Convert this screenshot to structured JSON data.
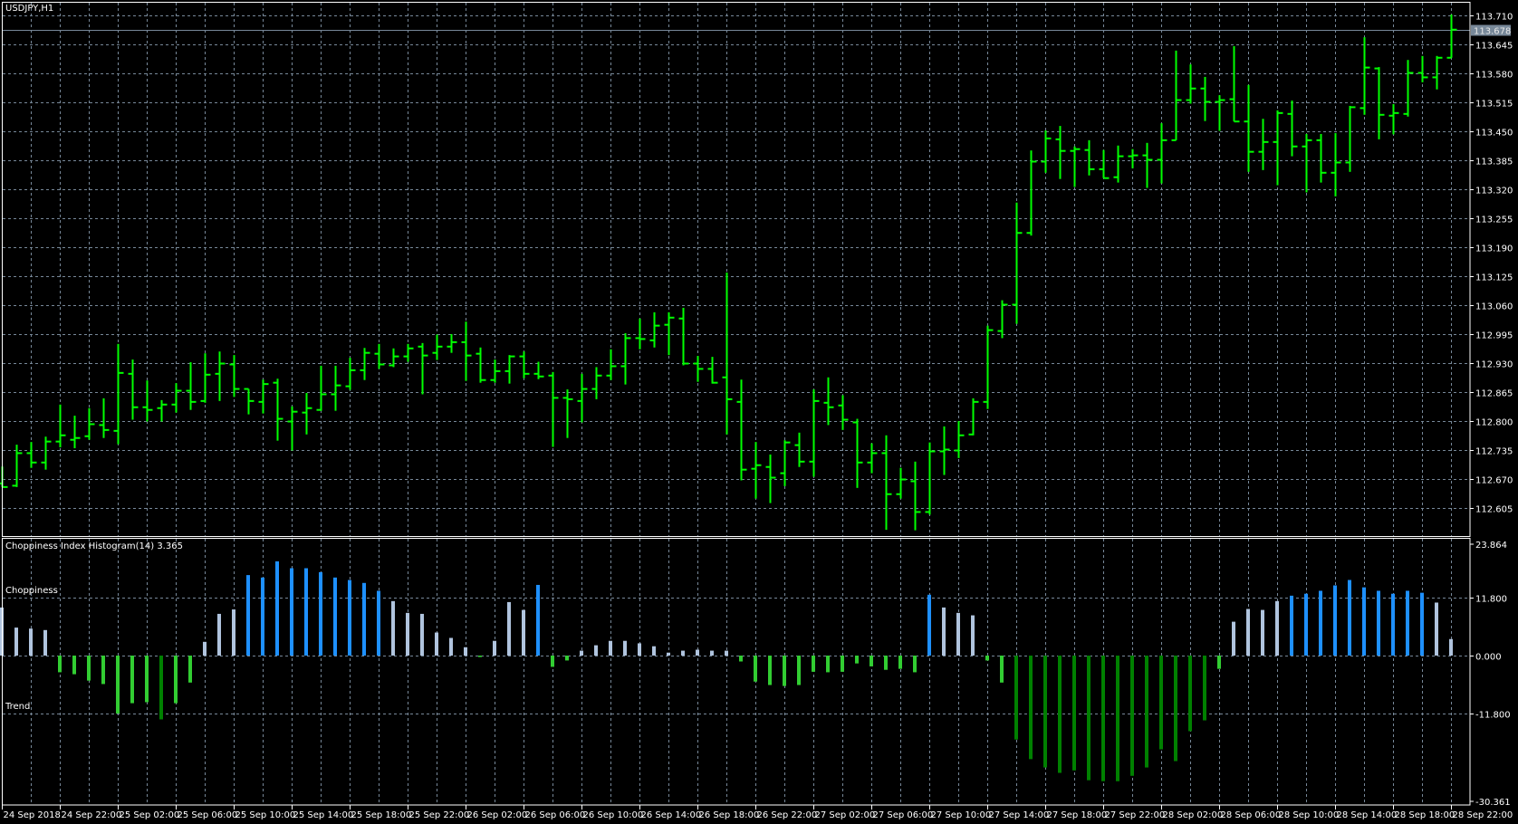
{
  "window": {
    "symbol_title": "USDJPY,H1"
  },
  "indicator": {
    "name": "Choppiness Index Histogram(14)",
    "current_value": "3.365",
    "level_labels": {
      "choppiness": "Choppiness",
      "trend": "Trend"
    }
  },
  "colors": {
    "background": "#000000",
    "grid": "#778899",
    "price_bar": "#00ff00",
    "current_price_line": "#778899",
    "hist_choppy_strong": "#1e90ff",
    "hist_choppy": "#b0c4de",
    "hist_trend": "#32cd32",
    "hist_trend_strong": "#008000"
  },
  "chart_data": [
    {
      "type": "bar",
      "style": "ohlc",
      "title": "USDJPY,H1",
      "ylim": [
        112.605,
        113.71
      ],
      "y_ticks": [
        "113.710",
        "113.645",
        "113.580",
        "113.515",
        "113.450",
        "113.385",
        "113.320",
        "113.255",
        "113.190",
        "113.125",
        "113.060",
        "112.995",
        "112.930",
        "112.865",
        "112.800",
        "112.735",
        "112.670",
        "112.605"
      ],
      "current_price": "113.678",
      "x_tick_labels": [
        "24 Sep 2018",
        "24 Sep 22:00",
        "25 Sep 02:00",
        "25 Sep 06:00",
        "25 Sep 10:00",
        "25 Sep 14:00",
        "25 Sep 18:00",
        "25 Sep 22:00",
        "26 Sep 02:00",
        "26 Sep 06:00",
        "26 Sep 10:00",
        "26 Sep 14:00",
        "26 Sep 18:00",
        "26 Sep 22:00",
        "27 Sep 02:00",
        "27 Sep 06:00",
        "27 Sep 10:00",
        "27 Sep 14:00",
        "27 Sep 18:00",
        "27 Sep 22:00",
        "28 Sep 02:00",
        "28 Sep 06:00",
        "28 Sep 10:00",
        "28 Sep 14:00",
        "28 Sep 18:00",
        "28 Sep 22:00"
      ],
      "grid": true,
      "ohlc": [
        [
          112.66,
          112.698,
          112.652,
          112.652
        ],
        [
          112.655,
          112.747,
          112.652,
          112.728
        ],
        [
          112.728,
          112.753,
          112.695,
          112.707
        ],
        [
          112.707,
          112.765,
          112.691,
          112.754
        ],
        [
          112.754,
          112.837,
          112.741,
          112.768
        ],
        [
          112.758,
          112.812,
          112.739,
          112.762
        ],
        [
          112.766,
          112.829,
          112.758,
          112.793
        ],
        [
          112.791,
          112.851,
          112.762,
          112.78
        ],
        [
          112.778,
          112.973,
          112.748,
          112.908
        ],
        [
          112.906,
          112.938,
          112.803,
          112.831
        ],
        [
          112.831,
          112.891,
          112.799,
          112.825
        ],
        [
          112.829,
          112.847,
          112.799,
          112.837
        ],
        [
          112.837,
          112.885,
          112.819,
          112.868
        ],
        [
          112.868,
          112.932,
          112.825,
          112.843
        ],
        [
          112.845,
          112.952,
          112.841,
          112.904
        ],
        [
          112.906,
          112.956,
          112.845,
          112.929
        ],
        [
          112.927,
          112.948,
          112.854,
          112.872
        ],
        [
          112.872,
          112.872,
          112.815,
          112.845
        ],
        [
          112.843,
          112.893,
          112.817,
          112.883
        ],
        [
          112.886,
          112.895,
          112.756,
          112.805
        ],
        [
          112.799,
          112.833,
          112.734,
          112.821
        ],
        [
          112.819,
          112.863,
          112.77,
          112.829
        ],
        [
          112.825,
          112.924,
          112.823,
          112.86
        ],
        [
          112.86,
          112.924,
          112.823,
          112.88
        ],
        [
          112.878,
          112.942,
          112.87,
          112.914
        ],
        [
          112.914,
          112.964,
          112.892,
          112.953
        ],
        [
          112.951,
          112.973,
          112.917,
          112.927
        ],
        [
          112.925,
          112.963,
          112.921,
          112.945
        ],
        [
          112.945,
          112.973,
          112.933,
          112.963
        ],
        [
          112.967,
          112.975,
          112.86,
          112.947
        ],
        [
          112.953,
          112.994,
          112.937,
          112.967
        ],
        [
          112.967,
          112.995,
          112.953,
          112.977
        ],
        [
          112.977,
          113.023,
          112.89,
          112.947
        ],
        [
          112.951,
          112.965,
          112.886,
          112.892
        ],
        [
          112.892,
          112.938,
          112.886,
          112.912
        ],
        [
          112.912,
          112.948,
          112.884,
          112.945
        ],
        [
          112.945,
          112.956,
          112.896,
          112.906
        ],
        [
          112.906,
          112.933,
          112.894,
          112.9
        ],
        [
          112.902,
          112.91,
          112.742,
          112.852
        ],
        [
          112.852,
          112.871,
          112.762,
          112.849
        ],
        [
          112.845,
          112.906,
          112.797,
          112.872
        ],
        [
          112.872,
          112.921,
          112.849,
          112.902
        ],
        [
          112.902,
          112.961,
          112.892,
          112.923
        ],
        [
          112.923,
          112.997,
          112.882,
          112.986
        ],
        [
          112.986,
          113.03,
          112.961,
          112.984
        ],
        [
          112.981,
          113.044,
          112.965,
          113.014
        ],
        [
          113.016,
          113.044,
          112.948,
          113.032
        ],
        [
          113.03,
          113.054,
          112.925,
          112.929
        ],
        [
          112.929,
          112.946,
          112.888,
          112.917
        ],
        [
          112.917,
          112.944,
          112.884,
          112.886
        ],
        [
          112.898,
          113.133,
          112.77,
          112.849
        ],
        [
          112.843,
          112.893,
          112.667,
          112.691
        ],
        [
          112.693,
          112.753,
          112.626,
          112.701
        ],
        [
          112.697,
          112.725,
          112.616,
          112.673
        ],
        [
          112.683,
          112.757,
          112.654,
          112.752
        ],
        [
          112.746,
          112.774,
          112.697,
          112.709
        ],
        [
          112.709,
          112.871,
          112.675,
          112.845
        ],
        [
          112.841,
          112.898,
          112.791,
          112.831
        ],
        [
          112.835,
          112.858,
          112.78,
          112.803
        ],
        [
          112.797,
          112.805,
          112.65,
          112.707
        ],
        [
          112.707,
          112.75,
          112.683,
          112.728
        ],
        [
          112.728,
          112.768,
          112.556,
          112.636
        ],
        [
          112.636,
          112.695,
          112.626,
          112.669
        ],
        [
          112.665,
          112.709,
          112.555,
          112.596
        ],
        [
          112.596,
          112.752,
          112.59,
          112.732
        ],
        [
          112.732,
          112.788,
          112.679,
          112.736
        ],
        [
          112.734,
          112.8,
          112.717,
          112.768
        ],
        [
          112.77,
          112.851,
          112.768,
          112.843
        ],
        [
          112.843,
          113.014,
          112.827,
          113.004
        ],
        [
          113.002,
          113.071,
          112.986,
          113.061
        ],
        [
          113.061,
          113.29,
          113.018,
          113.222
        ],
        [
          113.222,
          113.407,
          113.216,
          113.382
        ],
        [
          113.382,
          113.452,
          113.357,
          113.434
        ],
        [
          113.432,
          113.462,
          113.343,
          113.406
        ],
        [
          113.406,
          113.416,
          113.325,
          113.41
        ],
        [
          113.408,
          113.43,
          113.351,
          113.365
        ],
        [
          113.365,
          113.408,
          113.345,
          113.345
        ],
        [
          113.347,
          113.418,
          113.335,
          113.394
        ],
        [
          113.394,
          113.41,
          113.367,
          113.396
        ],
        [
          113.396,
          113.424,
          113.323,
          113.386
        ],
        [
          113.386,
          113.468,
          113.333,
          113.43
        ],
        [
          113.43,
          113.631,
          113.43,
          113.52
        ],
        [
          113.52,
          113.6,
          113.512,
          113.546
        ],
        [
          113.546,
          113.572,
          113.473,
          113.516
        ],
        [
          113.516,
          113.531,
          113.451,
          113.52
        ],
        [
          113.522,
          113.641,
          113.472,
          113.472
        ],
        [
          113.472,
          113.554,
          113.359,
          113.404
        ],
        [
          113.404,
          113.478,
          113.363,
          113.426
        ],
        [
          113.426,
          113.497,
          113.329,
          113.491
        ],
        [
          113.489,
          113.519,
          113.394,
          113.416
        ],
        [
          113.416,
          113.444,
          113.313,
          113.43
        ],
        [
          113.43,
          113.444,
          113.335,
          113.357
        ],
        [
          113.357,
          113.446,
          113.304,
          113.38
        ],
        [
          113.38,
          113.507,
          113.359,
          113.504
        ],
        [
          113.502,
          113.661,
          113.487,
          113.593
        ],
        [
          113.591,
          113.594,
          113.432,
          113.487
        ],
        [
          113.485,
          113.511,
          113.443,
          113.491
        ],
        [
          113.489,
          113.61,
          113.483,
          113.581
        ],
        [
          113.581,
          113.619,
          113.56,
          113.571
        ],
        [
          113.571,
          113.619,
          113.544,
          113.615
        ],
        [
          113.615,
          113.712,
          113.615,
          113.678
        ]
      ]
    },
    {
      "type": "bar",
      "title": "Choppiness Index Histogram(14) 3.365",
      "ylim": [
        -30.361,
        23.864
      ],
      "y_ticks": [
        "23.864",
        "11.800",
        "0.000",
        "-11.800",
        "-30.361"
      ],
      "levels": [
        11.8,
        -11.8
      ],
      "values": [
        9.8,
        5.7,
        5.5,
        5.2,
        -3.4,
        -3.8,
        -5.1,
        -5.8,
        -11.8,
        -9.7,
        -9.5,
        -13.0,
        -9.7,
        -5.5,
        2.8,
        8.5,
        9.4,
        16.4,
        15.9,
        19.2,
        17.8,
        17.8,
        17.0,
        15.9,
        15.4,
        14.8,
        13.2,
        11.1,
        8.7,
        8.5,
        4.7,
        3.6,
        1.7,
        -0.3,
        3.0,
        10.9,
        9.3,
        14.4,
        -2.3,
        -1.0,
        1.0,
        2.1,
        3.0,
        3.0,
        2.5,
        1.9,
        0.6,
        1.0,
        1.2,
        1.0,
        1.0,
        -1.2,
        -5.3,
        -6.0,
        -6.2,
        -6.0,
        -3.3,
        -3.4,
        -3.3,
        -1.6,
        -2.2,
        -2.9,
        -2.7,
        -3.4,
        12.4,
        9.8,
        8.7,
        8.2,
        -1.0,
        -5.5,
        -17.1,
        -21.1,
        -22.8,
        -23.9,
        -23.4,
        -25.4,
        -25.6,
        -25.6,
        -24.5,
        -22.8,
        -19.1,
        -21.5,
        -15.4,
        -13.2,
        -2.7,
        6.9,
        9.5,
        9.3,
        11.1,
        12.2,
        12.6,
        13.2,
        14.3,
        15.4,
        13.9,
        13.2,
        12.6,
        13.2,
        12.8,
        10.8,
        3.365
      ]
    }
  ]
}
